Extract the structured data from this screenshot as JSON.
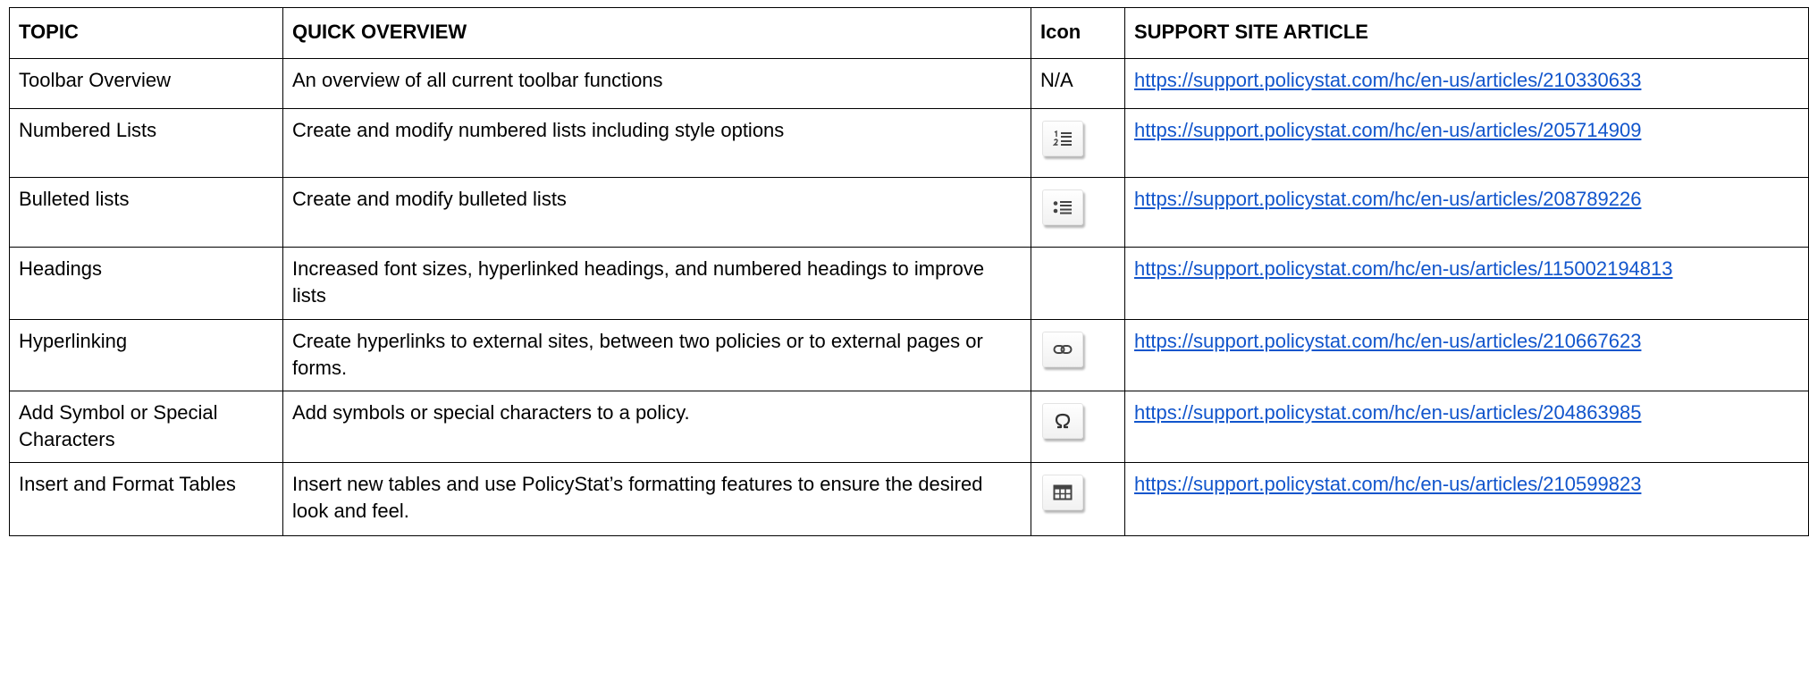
{
  "table": {
    "headers": {
      "topic": "TOPIC",
      "overview": "QUICK OVERVIEW",
      "icon": "Icon",
      "article": "SUPPORT SITE ARTICLE"
    },
    "rows": [
      {
        "topic": "Toolbar Overview",
        "overview": "An overview of all current toolbar functions",
        "icon_text": "N/A",
        "icon": "none",
        "article": "https://support.policystat.com/hc/en-us/articles/210330633"
      },
      {
        "topic": "Numbered Lists",
        "overview": "Create and modify numbered lists including style options",
        "icon_text": "",
        "icon": "numbered-list-icon",
        "article": "https://support.policystat.com/hc/en-us/articles/205714909"
      },
      {
        "topic": "Bulleted lists",
        "overview": "Create and modify bulleted lists",
        "icon_text": "",
        "icon": "bulleted-list-icon",
        "article": "https://support.policystat.com/hc/en-us/articles/208789226"
      },
      {
        "topic": "Headings",
        "overview": "Increased font sizes, hyperlinked headings, and numbered headings to improve lists",
        "icon_text": "",
        "icon": "none",
        "article": "https://support.policystat.com/hc/en-us/articles/115002194813"
      },
      {
        "topic": "Hyperlinking",
        "overview": "Create hyperlinks to external sites, between two policies or to external pages or forms.",
        "icon_text": "",
        "icon": "link-icon",
        "article": "https://support.policystat.com/hc/en-us/articles/210667623"
      },
      {
        "topic": "Add Symbol or Special Characters",
        "overview": "Add symbols or special characters to a policy.",
        "icon_text": "",
        "icon": "omega-symbol-icon",
        "article": "https://support.policystat.com/hc/en-us/articles/204863985"
      },
      {
        "topic": "Insert and Format Tables",
        "overview": "Insert new tables and use PolicyStat’s formatting features to ensure the desired look and feel.",
        "icon_text": "",
        "icon": "table-icon",
        "article": "https://support.policystat.com/hc/en-us/articles/210599823"
      }
    ],
    "colors": {
      "link": "#1155cc",
      "border": "#000000",
      "icon": "#444444"
    }
  }
}
